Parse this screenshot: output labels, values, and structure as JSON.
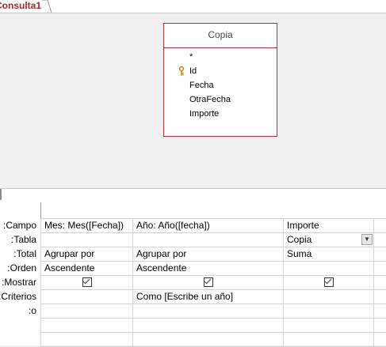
{
  "tab": {
    "label": "Consulta1"
  },
  "table_box": {
    "title": "Copia",
    "fields": [
      "*",
      "Id",
      "Fecha",
      "OtraFecha",
      "Importe"
    ],
    "key_field_index": 1
  },
  "grid": {
    "row_labels": [
      "Campo:",
      "Tabla:",
      "Total:",
      "Orden:",
      "Mostrar:",
      "Criterios:",
      "o:"
    ],
    "columns": [
      {
        "campo": "Mes: Mes([Fecha])",
        "tabla": "",
        "total": "Agrupar por",
        "orden": "Ascendente",
        "mostrar": true,
        "criterios": "",
        "o": ""
      },
      {
        "campo": "Año: Año([fecha])",
        "tabla": "",
        "total": "Agrupar por",
        "orden": "Ascendente",
        "mostrar": true,
        "criterios": "Como [Escribe un año]",
        "o": ""
      },
      {
        "campo": "Importe",
        "tabla": "Copia",
        "total": "Suma",
        "orden": "",
        "mostrar": true,
        "criterios": "",
        "o": ""
      }
    ]
  },
  "colors": {
    "accent": "#a4262c",
    "table_border": "#a4373a"
  }
}
